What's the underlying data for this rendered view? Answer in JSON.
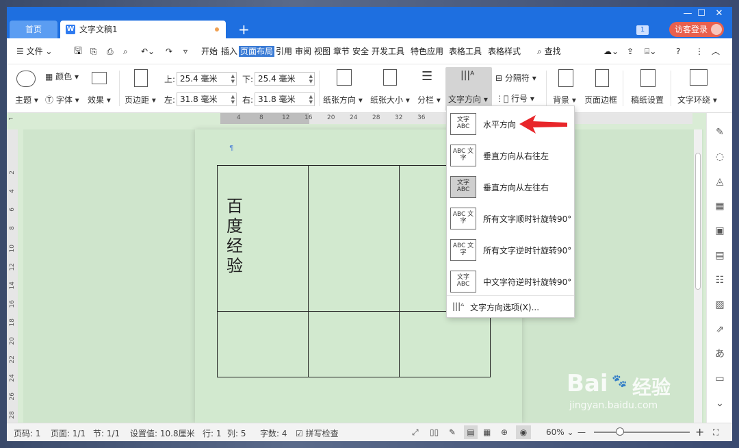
{
  "titlebar": {
    "home_tab": "首页",
    "doc_tab": "文字文稿1",
    "add_tab": "+",
    "badge": "1",
    "login": "访客登录"
  },
  "menubar": {
    "file": "文件",
    "items": [
      "开始",
      "插入",
      "页面布局",
      "引用",
      "审阅",
      "视图",
      "章节",
      "安全",
      "开发工具",
      "特色应用",
      "表格工具",
      "表格样式"
    ],
    "active": "页面布局",
    "search": "查找"
  },
  "ribbon": {
    "theme": "主题",
    "color": "颜色",
    "font": "字体",
    "effect": "效果",
    "margin": "页边距",
    "top_label": "上:",
    "top_value": "25.4 毫米",
    "bottom_label": "下:",
    "bottom_value": "25.4 毫米",
    "left_label": "左:",
    "left_value": "31.8 毫米",
    "right_label": "右:",
    "right_value": "31.8 毫米",
    "orientation": "纸张方向",
    "size": "纸张大小",
    "columns": "分栏",
    "text_direction": "文字方向",
    "separator": "分隔符",
    "line_number": "行号",
    "background": "背景",
    "page_border": "页面边框",
    "manuscript": "稿纸设置",
    "text_wrap": "文字环绕"
  },
  "ruler": {
    "top_ticks": [
      "4",
      "8",
      "12",
      "16",
      "20",
      "24",
      "28",
      "32",
      "36"
    ],
    "left_ticks": [
      "2",
      "4",
      "6",
      "8",
      "10",
      "12",
      "14",
      "16",
      "18",
      "20",
      "22",
      "24",
      "26",
      "28",
      "30"
    ]
  },
  "document": {
    "cell_text": "百度经验"
  },
  "dropdown": {
    "items": [
      {
        "icon_text": "文字 ABC",
        "label": "水平方向"
      },
      {
        "icon_text": "ABC 文字",
        "label": "垂直方向从右往左"
      },
      {
        "icon_text": "文字 ABC",
        "label": "垂直方向从左往右"
      },
      {
        "icon_text": "ABC 文字",
        "label": "所有文字顺时针旋转90°"
      },
      {
        "icon_text": "ABC 文字",
        "label": "所有文字逆时针旋转90°"
      },
      {
        "icon_text": "文字 ABC",
        "label": "中文字符逆时针旋转90°"
      }
    ],
    "footer": "文字方向选项(X)...",
    "selected_index": 2
  },
  "statusbar": {
    "page_code": "页码: 1",
    "page": "页面: 1/1",
    "section": "节: 1/1",
    "setting": "设置值: 10.8厘米",
    "row": "行: 1",
    "col": "列: 5",
    "word_count": "字数: 4",
    "spell_check": "拼写检查",
    "zoom": "60%"
  },
  "watermark": {
    "brand": "Bai",
    "brand2": "经验",
    "url": "jingyan.baidu.com"
  },
  "colors": {
    "accent": "#1e6fe0",
    "doc_bg": "#d2e9cf",
    "arrow": "#e8262a"
  }
}
